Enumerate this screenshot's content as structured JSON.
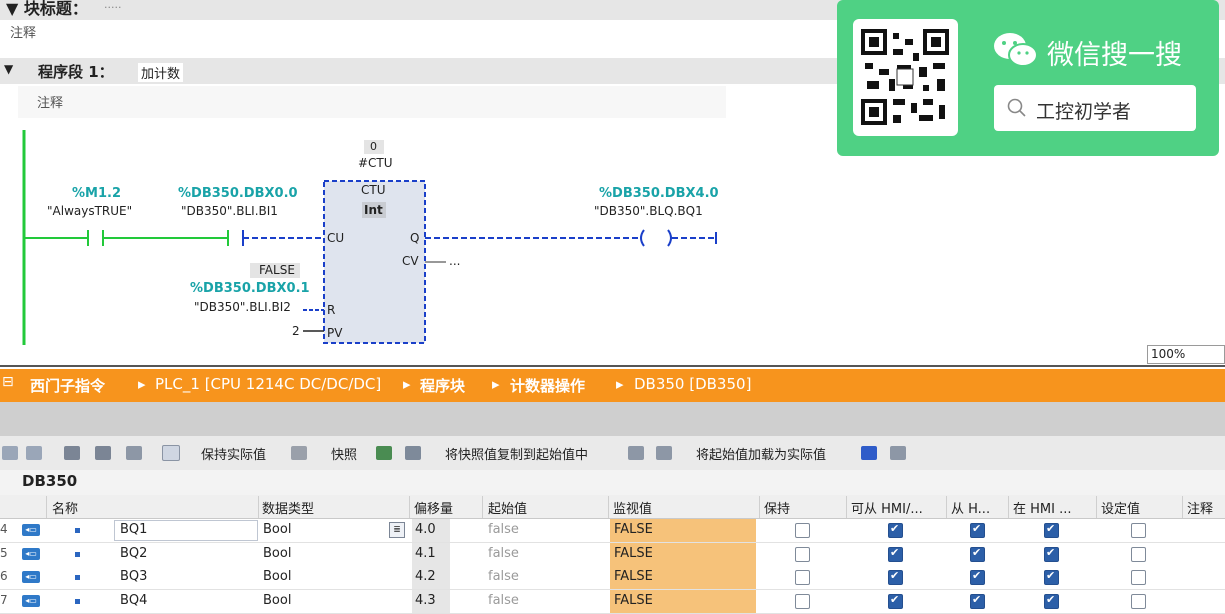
{
  "editor": {
    "block_title_label": "▼ 块标题：",
    "block_title_value": ".....",
    "comment1": "注释",
    "segment_title": "程序段 1：",
    "segment_name": "加计数",
    "comment2": "注释",
    "zoom": "100%"
  },
  "ladder": {
    "contact1_addr": "%M1.2",
    "contact1_name": "\"AlwaysTRUE\"",
    "contact2_addr": "%DB350.DBX0.0",
    "contact2_name": "\"DB350\".BLI.BI1",
    "instance_value": "0",
    "instance_name": "#CTU",
    "block_type": "CTU",
    "block_dtype": "Int",
    "pin_cu": "CU",
    "pin_q": "Q",
    "pin_cv": "CV",
    "cv_value": "...",
    "pin_r": "R",
    "pin_pv": "PV",
    "r_state": "FALSE",
    "r_addr": "%DB350.DBX0.1",
    "r_name": "\"DB350\".BLI.BI2",
    "pv_value": "2",
    "coil_addr": "%DB350.DBX4.0",
    "coil_name": "\"DB350\".BLQ.BQ1"
  },
  "wechat": {
    "title": "微信搜一搜",
    "search_text": "工控初学者",
    "accent": "#4fd184"
  },
  "breadcrumb": {
    "items": [
      "西门子指令",
      "PLC_1 [CPU 1214C DC/DC/DC]",
      "程序块",
      "计数器操作",
      "DB350 [DB350]"
    ],
    "color": "#f7941d"
  },
  "toolbar": {
    "keep_actual": "保持实际值",
    "snapshot": "快照",
    "copy_snapshot": "将快照值复制到起始值中",
    "load_start": "将起始值加载为实际值"
  },
  "db_title": "DB350",
  "table": {
    "headers": [
      "名称",
      "数据类型",
      "偏移量",
      "起始值",
      "监视值",
      "保持",
      "可从 HMI/...",
      "从 H...",
      "在 HMI ...",
      "设定值",
      "注释"
    ],
    "rows": [
      {
        "num": "4",
        "name": "BQ1",
        "type": "Bool",
        "offset": "4.0",
        "start": "false",
        "monitor": "FALSE",
        "retain": false,
        "hmi1": true,
        "hmi2": true,
        "hmi3": true,
        "setpoint": false
      },
      {
        "num": "5",
        "name": "BQ2",
        "type": "Bool",
        "offset": "4.1",
        "start": "false",
        "monitor": "FALSE",
        "retain": false,
        "hmi1": true,
        "hmi2": true,
        "hmi3": true,
        "setpoint": false
      },
      {
        "num": "6",
        "name": "BQ3",
        "type": "Bool",
        "offset": "4.2",
        "start": "false",
        "monitor": "FALSE",
        "retain": false,
        "hmi1": true,
        "hmi2": true,
        "hmi3": true,
        "setpoint": false
      },
      {
        "num": "7",
        "name": "BQ4",
        "type": "Bool",
        "offset": "4.3",
        "start": "false",
        "monitor": "FALSE",
        "retain": false,
        "hmi1": true,
        "hmi2": true,
        "hmi3": true,
        "setpoint": false
      }
    ]
  }
}
